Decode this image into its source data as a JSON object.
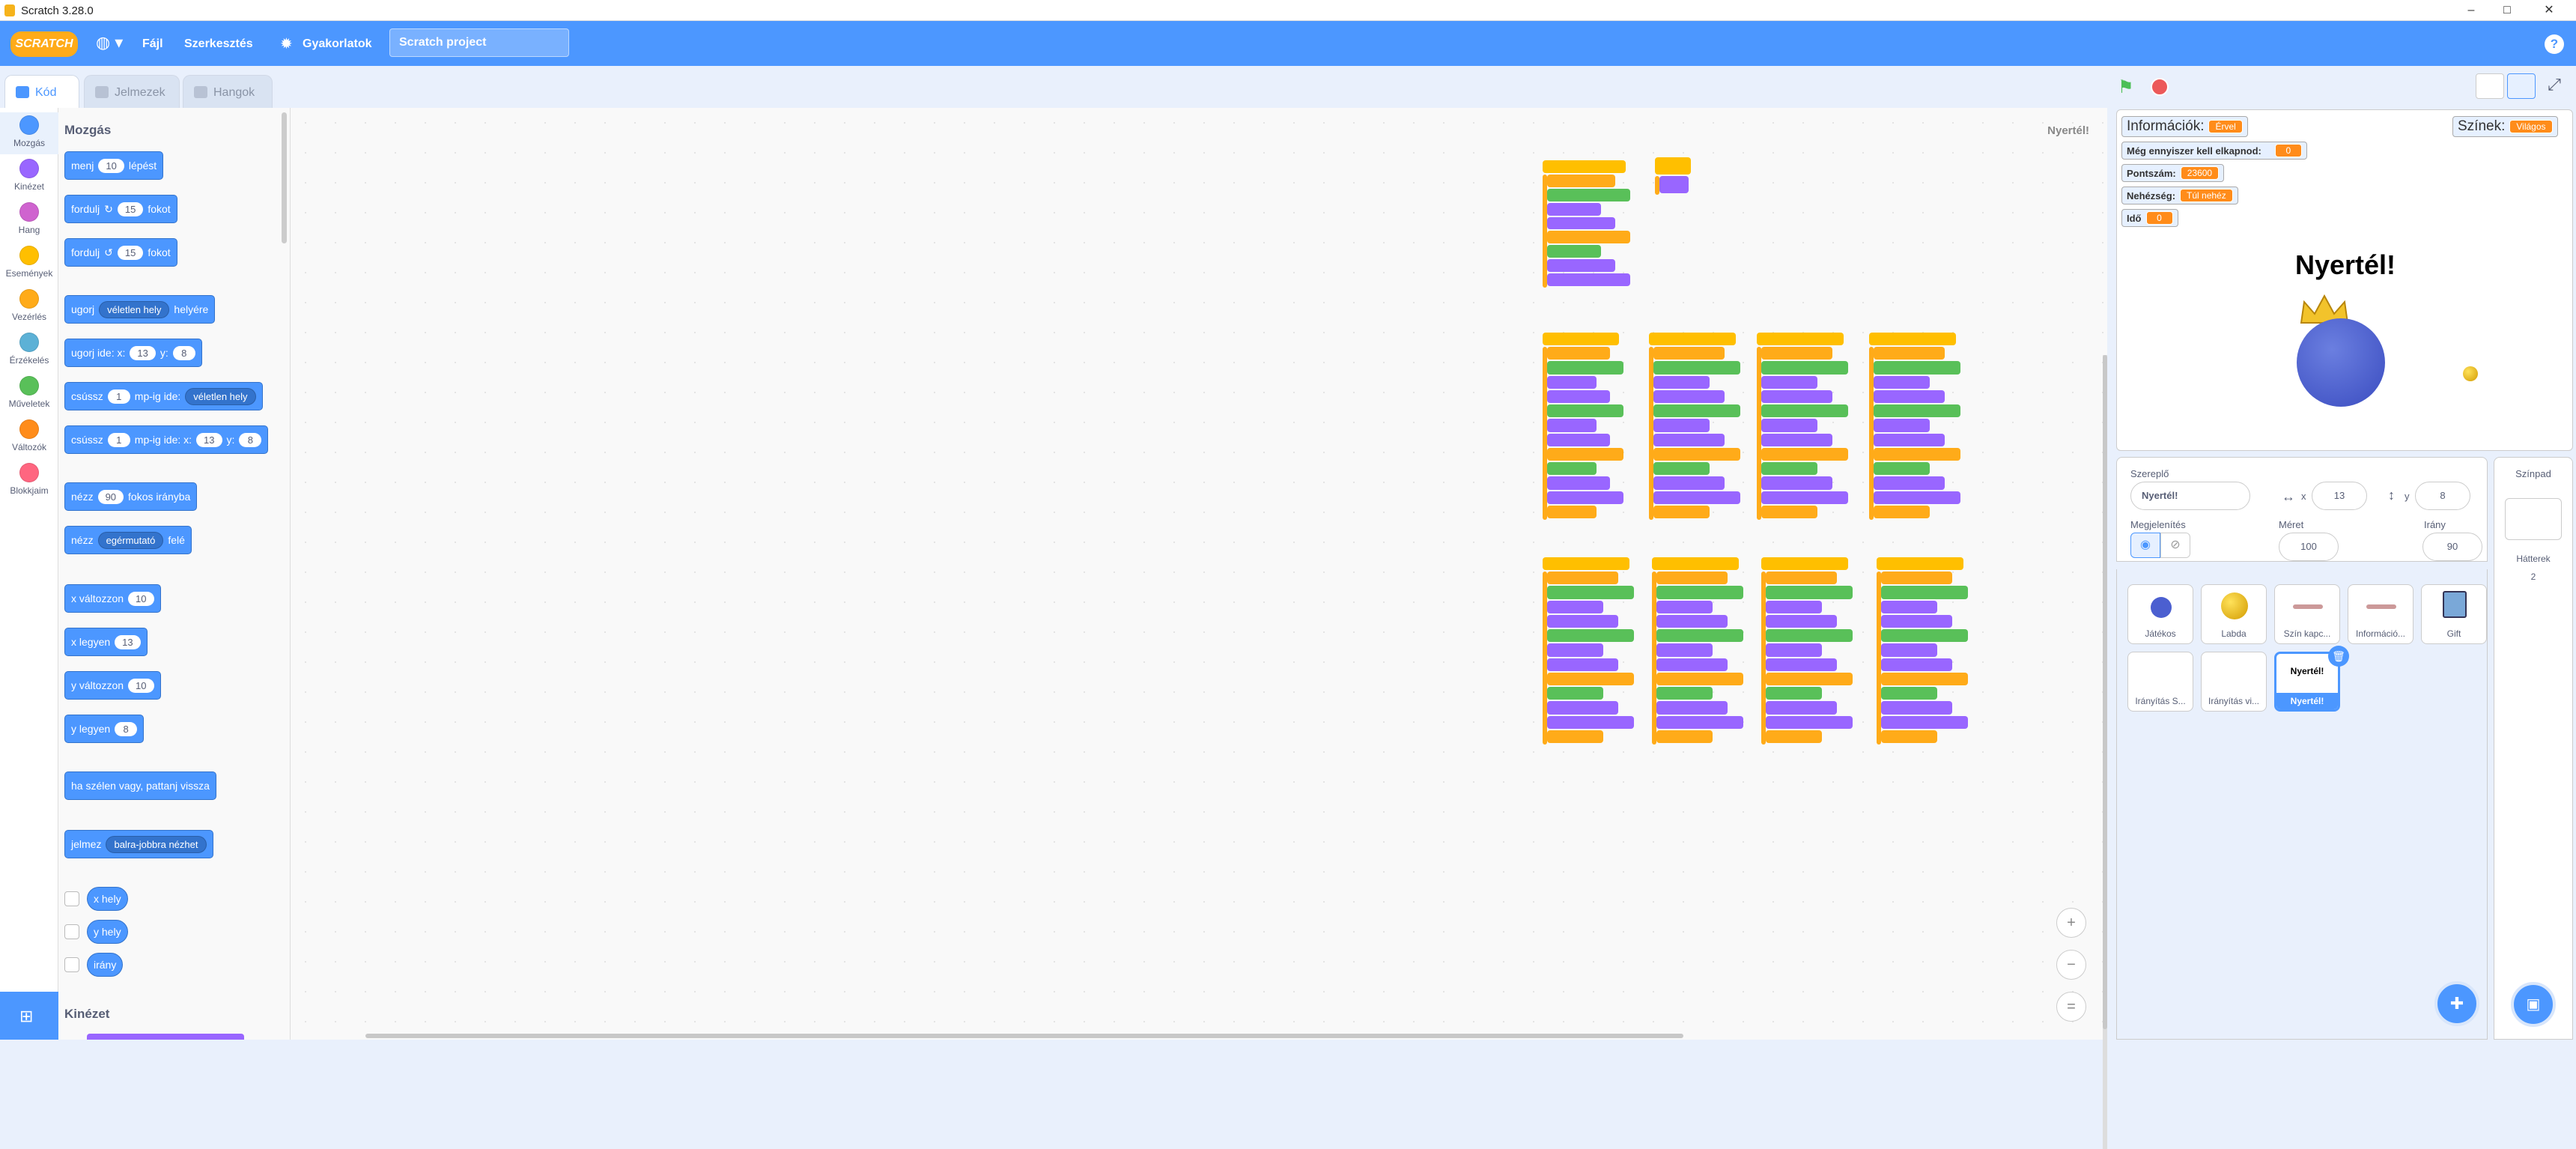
{
  "window": {
    "title": "Scratch 3.28.0",
    "min": "–",
    "max": "□",
    "close": "✕"
  },
  "menubar": {
    "logo": "SCRATCH",
    "file": "Fájl",
    "edit": "Szerkesztés",
    "tutorials": "Gyakorlatok",
    "project_title": "Scratch project",
    "help": "?"
  },
  "tabs": {
    "code": "Kód",
    "costumes": "Jelmezek",
    "sounds": "Hangok"
  },
  "categories": [
    {
      "label": "Mozgás",
      "color": "#4c97ff"
    },
    {
      "label": "Kinézet",
      "color": "#9966ff"
    },
    {
      "label": "Hang",
      "color": "#cf63cf"
    },
    {
      "label": "Események",
      "color": "#ffbf00"
    },
    {
      "label": "Vezérlés",
      "color": "#ffab19"
    },
    {
      "label": "Érzékelés",
      "color": "#5cb1d6"
    },
    {
      "label": "Műveletek",
      "color": "#59c059"
    },
    {
      "label": "Változók",
      "color": "#ff8c1a"
    },
    {
      "label": "Blokkjaim",
      "color": "#ff6680"
    }
  ],
  "palette": {
    "motion_header": "Mozgás",
    "looks_header": "Kinézet",
    "move": {
      "a": "menj",
      "n": "10",
      "b": "lépést"
    },
    "turn_right": {
      "a": "fordulj",
      "n": "15",
      "b": "fokot"
    },
    "turn_left": {
      "a": "fordulj",
      "n": "15",
      "b": "fokot"
    },
    "goto": {
      "a": "ugorj",
      "dd": "véletlen hely",
      "b": "helyére"
    },
    "gotoxy": {
      "a": "ugorj ide: x:",
      "x": "13",
      "ylbl": "y:",
      "y": "8"
    },
    "glide": {
      "a": "csússz",
      "n": "1",
      "b": "mp-ig ide:",
      "dd": "véletlen hely"
    },
    "glidexy": {
      "a": "csússz",
      "n": "1",
      "b": "mp-ig ide: x:",
      "x": "13",
      "ylbl": "y:",
      "y": "8"
    },
    "point": {
      "a": "nézz",
      "n": "90",
      "b": "fokos irányba"
    },
    "pointto": {
      "a": "nézz",
      "dd": "egérmutató",
      "b": "felé"
    },
    "changex": {
      "a": "x változzon",
      "n": "10"
    },
    "setx": {
      "a": "x legyen",
      "n": "13"
    },
    "changey": {
      "a": "y változzon",
      "n": "10"
    },
    "sety": {
      "a": "y legyen",
      "n": "8"
    },
    "bounce": "ha szélen vagy, pattanj vissza",
    "rotstyle": {
      "a": "jelmez",
      "dd": "balra-jobbra nézhet"
    },
    "xpos": "x hely",
    "ypos": "y hely",
    "dir": "irány"
  },
  "workspace": {
    "sprite_label": "Nyertél!",
    "zoom_in": "+",
    "zoom_out": "−",
    "zoom_reset": "="
  },
  "stage": {
    "monitors": {
      "info": {
        "label": "Információk:",
        "value": "Érvel"
      },
      "colors": {
        "label": "Színek:",
        "value": "Világos"
      },
      "lives": {
        "label": "Még ennyiszer kell elkapnod:",
        "value": "0"
      },
      "score": {
        "label": "Pontszám:",
        "value": "23600"
      },
      "difficulty": {
        "label": "Nehézség:",
        "value": "Túl nehéz"
      },
      "time": {
        "label": "Idő",
        "value": "0"
      }
    },
    "win_text": "Nyertél!"
  },
  "sprite_info": {
    "sprite_label": "Szereplő",
    "name": "Nyertél!",
    "x_label": "x",
    "x": "13",
    "y_label": "y",
    "y": "8",
    "show_label": "Megjelenítés",
    "size_label": "Méret",
    "size": "100",
    "direction_label": "Irány",
    "direction": "90"
  },
  "sprites": [
    {
      "name": "Játékos"
    },
    {
      "name": "Labda"
    },
    {
      "name": "Szín kapc..."
    },
    {
      "name": "Információ..."
    },
    {
      "name": "Gift"
    },
    {
      "name": "Irányítás S..."
    },
    {
      "name": "Irányítás vi..."
    },
    {
      "name": "Nyertél!",
      "selected": true,
      "thumb": "Nyertél!"
    }
  ],
  "backdrop": {
    "title": "Színpad",
    "label": "Hátterek",
    "count": "2"
  },
  "colors": {
    "motion": "#4c97ff",
    "events": "#ffbf00",
    "control": "#ffab19",
    "looks": "#9966ff",
    "operators": "#59c059",
    "variables": "#ff8c1a"
  }
}
